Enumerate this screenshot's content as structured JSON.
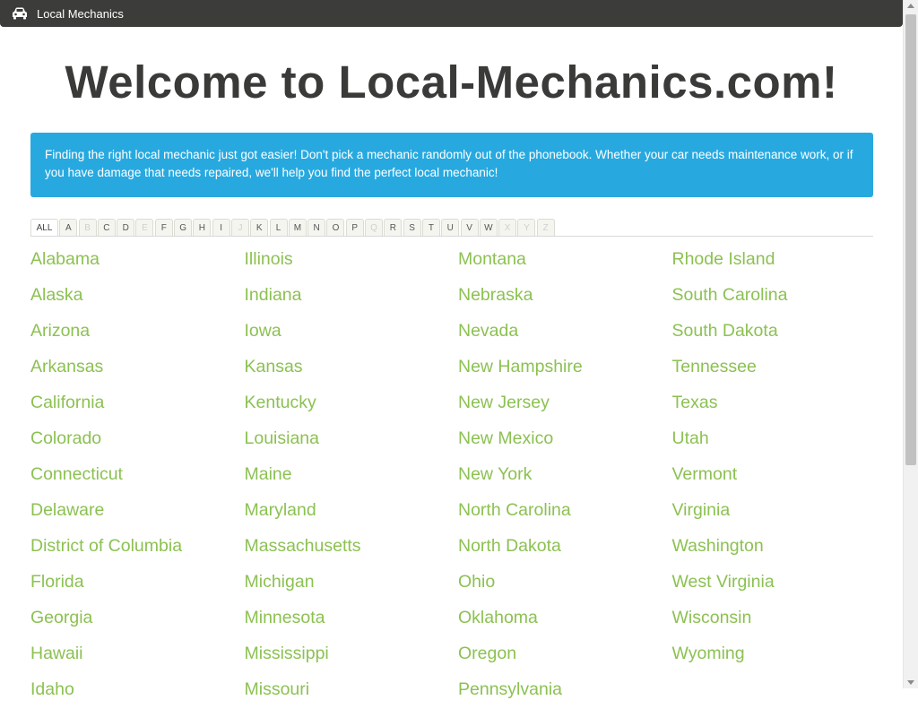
{
  "app": {
    "title": "Local Mechanics",
    "icon": "car-icon"
  },
  "main": {
    "heading": "Welcome to Local-Mechanics.com!",
    "intro": "Finding the right local mechanic just got easier! Don't pick a mechanic randomly out of the phonebook. Whether your car needs maintenance work, or if you have damage that needs repaired, we'll help you find the perfect local mechanic!",
    "alphabet": [
      {
        "label": "ALL",
        "enabled": true,
        "active": true
      },
      {
        "label": "A",
        "enabled": true
      },
      {
        "label": "B",
        "enabled": false
      },
      {
        "label": "C",
        "enabled": true
      },
      {
        "label": "D",
        "enabled": true
      },
      {
        "label": "E",
        "enabled": false
      },
      {
        "label": "F",
        "enabled": true
      },
      {
        "label": "G",
        "enabled": true
      },
      {
        "label": "H",
        "enabled": true
      },
      {
        "label": "I",
        "enabled": true
      },
      {
        "label": "J",
        "enabled": false
      },
      {
        "label": "K",
        "enabled": true
      },
      {
        "label": "L",
        "enabled": true
      },
      {
        "label": "M",
        "enabled": true
      },
      {
        "label": "N",
        "enabled": true
      },
      {
        "label": "O",
        "enabled": true
      },
      {
        "label": "P",
        "enabled": true
      },
      {
        "label": "Q",
        "enabled": false
      },
      {
        "label": "R",
        "enabled": true
      },
      {
        "label": "S",
        "enabled": true
      },
      {
        "label": "T",
        "enabled": true
      },
      {
        "label": "U",
        "enabled": true
      },
      {
        "label": "V",
        "enabled": true
      },
      {
        "label": "W",
        "enabled": true
      },
      {
        "label": "X",
        "enabled": false
      },
      {
        "label": "Y",
        "enabled": false
      },
      {
        "label": "Z",
        "enabled": false
      }
    ],
    "state_columns": [
      [
        "Alabama",
        "Alaska",
        "Arizona",
        "Arkansas",
        "California",
        "Colorado",
        "Connecticut",
        "Delaware",
        "District of Columbia",
        "Florida",
        "Georgia",
        "Hawaii",
        "Idaho"
      ],
      [
        "Illinois",
        "Indiana",
        "Iowa",
        "Kansas",
        "Kentucky",
        "Louisiana",
        "Maine",
        "Maryland",
        "Massachusetts",
        "Michigan",
        "Minnesota",
        "Mississippi",
        "Missouri"
      ],
      [
        "Montana",
        "Nebraska",
        "Nevada",
        "New Hampshire",
        "New Jersey",
        "New Mexico",
        "New York",
        "North Carolina",
        "North Dakota",
        "Ohio",
        "Oklahoma",
        "Oregon",
        "Pennsylvania"
      ],
      [
        "Rhode Island",
        "South Carolina",
        "South Dakota",
        "Tennessee",
        "Texas",
        "Utah",
        "Vermont",
        "Virginia",
        "Washington",
        "West Virginia",
        "Wisconsin",
        "Wyoming"
      ]
    ]
  },
  "colors": {
    "topbar": "#3c3c3a",
    "banner": "#27a9e0",
    "link": "#8cc152",
    "heading": "#3a3a38"
  }
}
